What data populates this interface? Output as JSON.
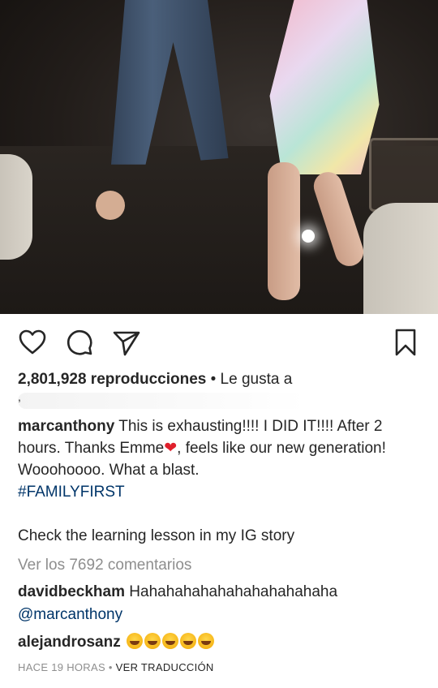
{
  "post": {
    "views_count": "2,801,928 reproducciones",
    "liked_by_prefix": "• Le gusta a",
    "liked_by_names": ",",
    "caption": {
      "username": "marcanthony",
      "text_1": " This is exhausting!!!! I DID IT!!!! After 2 hours. Thanks Emme",
      "heart_emoji": "❤",
      "text_2": ", feels like our new generation! Wooohoooo. What a blast.",
      "hashtag": "#FAMILYFIRST",
      "line_2": "Check the learning lesson in my IG story"
    },
    "view_all_comments": "Ver los 7692 comentarios",
    "comments": [
      {
        "username": "davidbeckham",
        "text": " Hahahahahahahahahahahaha",
        "mention": "@marcanthony"
      },
      {
        "username": "alejandrosanz",
        "emoji_count": 5
      }
    ],
    "timestamp": "HACE 19 HORAS",
    "separator": " • ",
    "translate_label": "VER TRADUCCIÓN"
  },
  "icons": {
    "like": "heart-outline-icon",
    "comment": "comment-bubble-icon",
    "share": "paper-plane-icon",
    "save": "bookmark-icon"
  },
  "colors": {
    "text": "#262626",
    "secondary": "#8e8e8e",
    "link": "#003569",
    "heart": "#e0202c"
  }
}
